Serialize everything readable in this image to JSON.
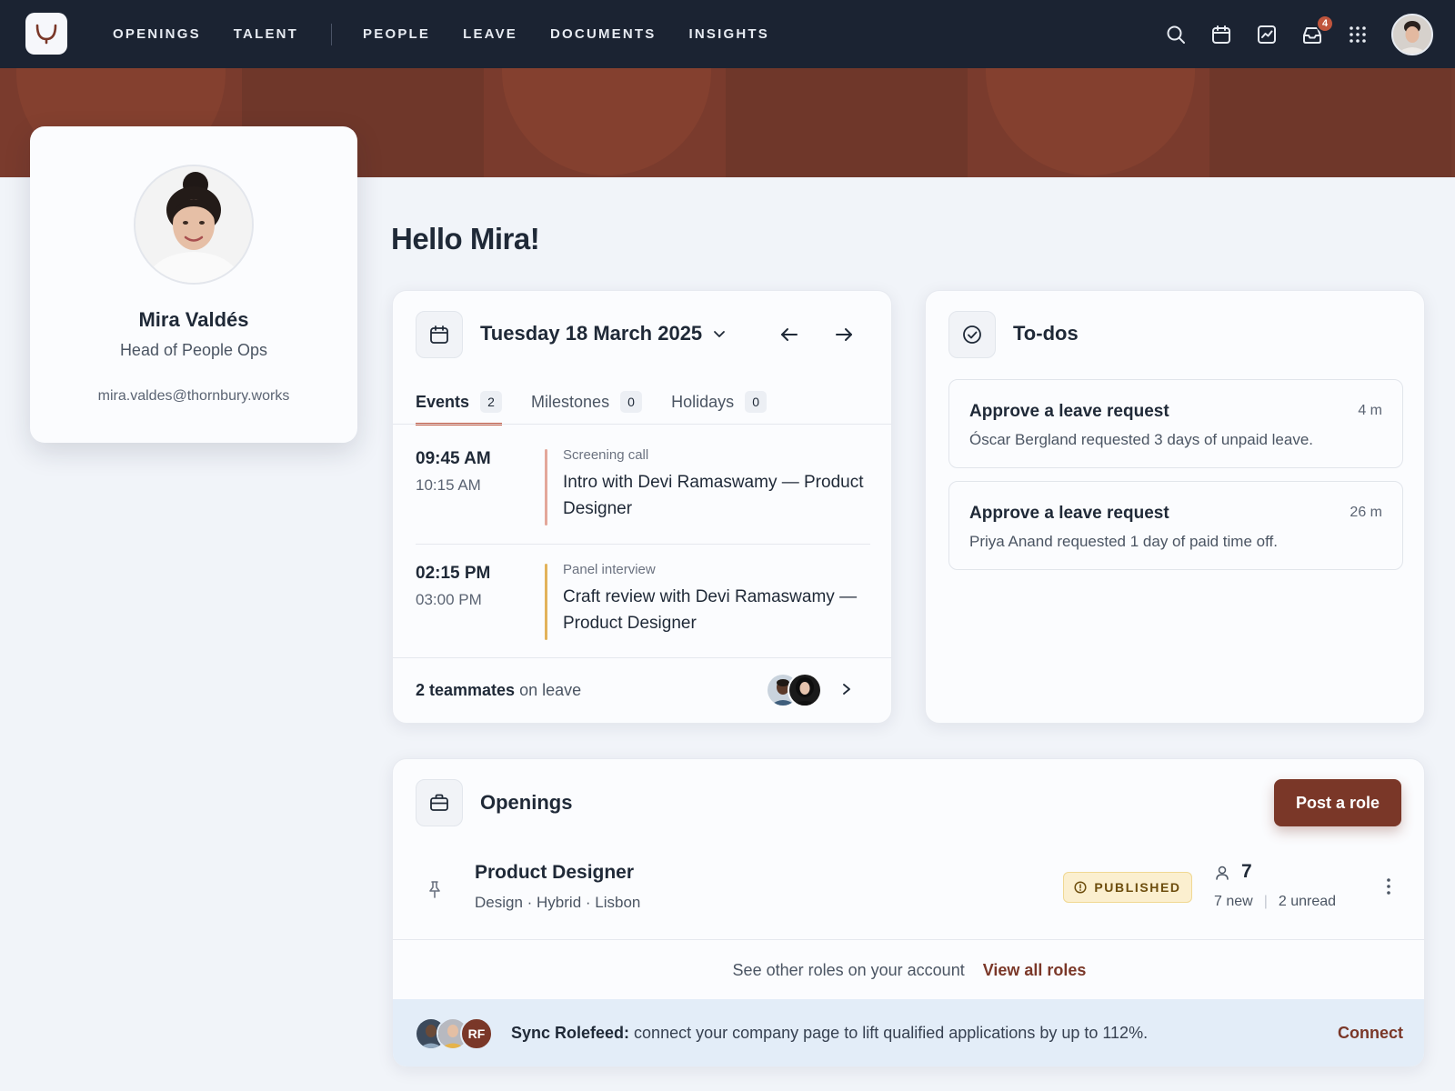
{
  "nav": {
    "links_primary": [
      "OPENINGS",
      "TALENT"
    ],
    "links_secondary": [
      "PEOPLE",
      "LEAVE",
      "DOCUMENTS",
      "INSIGHTS"
    ],
    "icons": [
      "search-icon",
      "calendar-icon",
      "chart-icon",
      "inbox-icon",
      "apps-grid-icon"
    ],
    "inbox_badge": "4"
  },
  "profile": {
    "name": "Mira Valdés",
    "role": "Head of People Ops",
    "email": "mira.valdes@thornbury.works"
  },
  "greeting": "Hello Mira!",
  "calendar": {
    "date_label": "Tuesday 18 March 2025",
    "tabs": [
      {
        "label": "Events",
        "count": "2"
      },
      {
        "label": "Milestones",
        "count": "0"
      },
      {
        "label": "Holidays",
        "count": "0"
      }
    ],
    "events": [
      {
        "start": "09:45 AM",
        "end": "10:15 AM",
        "kind": "Screening call",
        "title": "Intro with Devi Ramaswamy — Product Designer",
        "color": "#e3a79a"
      },
      {
        "start": "02:15 PM",
        "end": "03:00 PM",
        "kind": "Panel interview",
        "title": "Craft review with Devi Ramaswamy — Product Designer",
        "color": "#e2b25a"
      }
    ],
    "leave": {
      "count_label": "2 teammates",
      "suffix": " on leave"
    }
  },
  "todos": {
    "title": "To-dos",
    "items": [
      {
        "heading": "Approve a leave request",
        "detail": "Óscar Bergland requested 3 days of unpaid leave.",
        "ago": "4 m"
      },
      {
        "heading": "Approve a leave request",
        "detail": "Priya Anand requested 1 day of paid time off.",
        "ago": "26 m"
      }
    ]
  },
  "openings": {
    "title": "Openings",
    "post_button": "Post a role",
    "job": {
      "title": "Product Designer",
      "meta": "Design · Hybrid · Lisbon",
      "status": "PUBLISHED",
      "applicants": "7",
      "new_label": "7 new",
      "unread_label": "2 unread"
    },
    "other_roles_text": "See other roles on your account",
    "view_all": "View all roles",
    "sync": {
      "bold": "Sync Rolefeed:",
      "text": " connect your company page to lift qualified applications by up to 112%.",
      "initials": "RF",
      "connect": "Connect"
    }
  },
  "colors": {
    "nav_bg": "#1b2332",
    "banner": "#743a2c",
    "accent": "#7a3728",
    "tab_underline": "#c0553d"
  }
}
